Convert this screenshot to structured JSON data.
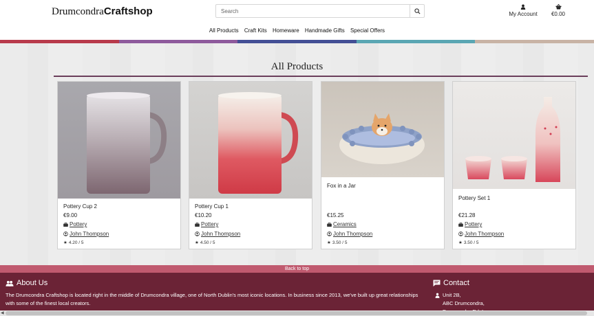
{
  "header": {
    "logo_part1": "Drumcondra",
    "logo_part2": "Craftshop",
    "search_placeholder": "Search",
    "account_label": "My Account",
    "basket_total": "€0.00"
  },
  "nav": {
    "items": [
      "All Products",
      "Craft Kits",
      "Homeware",
      "Handmade Gifts",
      "Special Offers"
    ]
  },
  "band_colors": [
    "#b83a4b",
    "#8e5a9c",
    "#434f95",
    "#5aa6b3",
    "#c8b3a5"
  ],
  "main": {
    "title": "All Products",
    "products": [
      {
        "name": "Pottery Cup 2",
        "price": "€9.00",
        "category": "Pottery",
        "maker": "John Thompson",
        "rating": "4.20 / 5"
      },
      {
        "name": "Pottery Cup 1",
        "price": "€10.20",
        "category": "Pottery",
        "maker": "John Thompson",
        "rating": "4.50 / 5"
      },
      {
        "name": "Fox in a Jar",
        "price": "€15.25",
        "category": "Ceramics",
        "maker": "John Thompson",
        "rating": "3.50 / 5"
      },
      {
        "name": "Pottery Set 1",
        "price": "€21.28",
        "category": "Pottery",
        "maker": "John Thompson",
        "rating": "3.50 / 5"
      }
    ]
  },
  "back_to_top": "Back to top",
  "footer": {
    "about_heading": "About Us",
    "about_text": "The Drumcondra Craftshop is located right in the middle of Drumcondra village, one of North Dublin's most iconic locations. In business since 2013, we've built up great relationships with some of the finest local creators.",
    "contact_heading": "Contact",
    "address_line1": "Unit 2B,",
    "address_line2": "ABC Drumcondra,",
    "address_line3": "Drumcondra Rd. Lower"
  }
}
